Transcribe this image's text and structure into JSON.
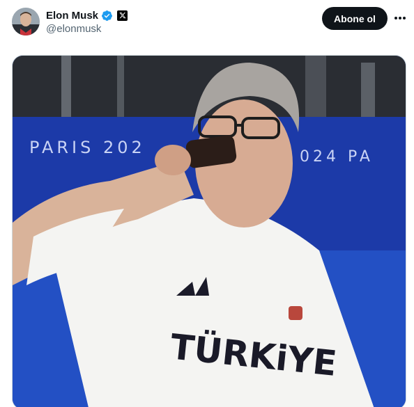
{
  "tweet": {
    "author": {
      "display_name": "Elon Musk",
      "handle": "@elonmusk",
      "verified": true,
      "affiliate_badge": "x-logo-icon"
    },
    "follow_label": "Abone ol",
    "more_icon": "more-horizontal-icon",
    "media": {
      "type": "video-frame",
      "banner_text_left": "PARIS 202",
      "banner_text_right": "024   PA",
      "shirt_text": "TÜRKiYE"
    }
  },
  "colors": {
    "verified": "#1d9bf0",
    "follow_button": "#0f1419",
    "handle": "#536471",
    "banner_blue": "#1c3aa8"
  }
}
